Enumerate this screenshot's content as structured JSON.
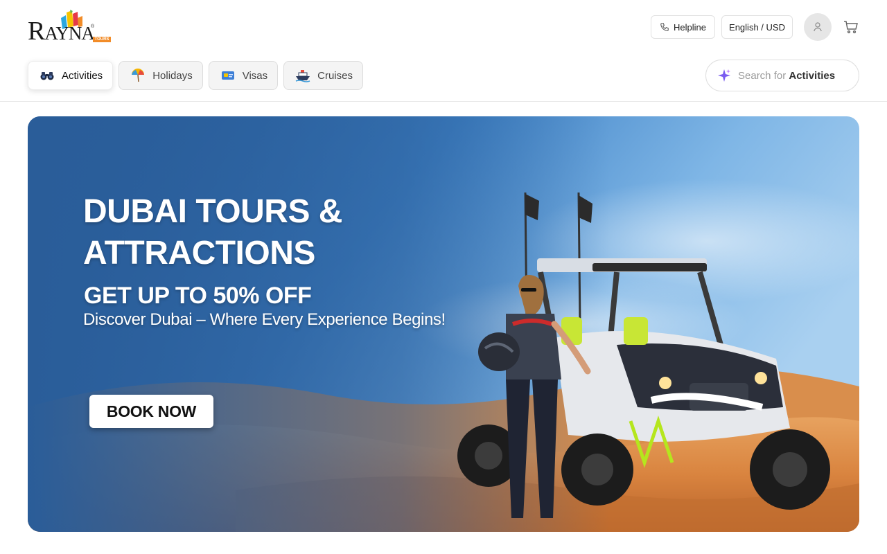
{
  "brand": {
    "logo_text": "RAYNA",
    "logo_badge": "TOURS",
    "registered_mark": "®"
  },
  "header": {
    "helpline_label": "Helpline",
    "language_currency_label": "English / USD",
    "icons": {
      "helpline": "phone-icon",
      "account": "user-icon",
      "cart": "cart-icon"
    }
  },
  "tabs": [
    {
      "label": "Activities",
      "icon": "binoculars-icon",
      "active": true
    },
    {
      "label": "Holidays",
      "icon": "umbrella-icon",
      "active": false
    },
    {
      "label": "Visas",
      "icon": "passport-icon",
      "active": false
    },
    {
      "label": "Cruises",
      "icon": "ship-icon",
      "active": false
    }
  ],
  "search": {
    "prefix": "Search for",
    "keyword": "Activities",
    "icon": "sparkle-icon"
  },
  "hero": {
    "title_line1": "DUBAI TOURS &",
    "title_line2": "ATTRACTIONS",
    "offer": "GET UP TO 50% OFF",
    "subtitle": "Discover Dubai – Where Every Experience Begins!",
    "cta_label": "BOOK NOW",
    "image": "woman-with-dune-buggy-in-desert"
  },
  "colors": {
    "sky_top": "#2f6fb4",
    "sky_light": "#8fc1ea",
    "sand": "#d9843f",
    "logo_accent": "#f28c28",
    "search_sparkle": "#7b5cf0"
  }
}
